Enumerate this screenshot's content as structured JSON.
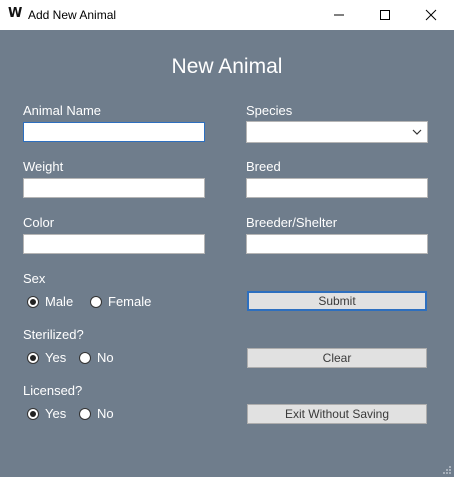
{
  "window": {
    "title": "Add New Animal",
    "icon_letter": "W",
    "controls": [
      "minimize-icon",
      "maximize-icon",
      "close-icon"
    ]
  },
  "form": {
    "title": "New Animal",
    "left": {
      "animal_name": {
        "label": "Animal Name",
        "value": ""
      },
      "weight": {
        "label": "Weight",
        "value": ""
      },
      "color": {
        "label": "Color",
        "value": ""
      }
    },
    "right": {
      "species": {
        "label": "Species",
        "selected": ""
      },
      "breed": {
        "label": "Breed",
        "value": ""
      },
      "breeder_shelter": {
        "label": "Breeder/Shelter",
        "value": ""
      }
    },
    "sex": {
      "label": "Sex",
      "options": [
        "Male",
        "Female"
      ],
      "selected": "Male"
    },
    "sterilized": {
      "label": "Sterilized?",
      "options": [
        "Yes",
        "No"
      ],
      "selected": "Yes"
    },
    "licensed": {
      "label": "Licensed?",
      "options": [
        "Yes",
        "No"
      ],
      "selected": "Yes"
    },
    "buttons": {
      "submit": "Submit",
      "clear": "Clear",
      "exit": "Exit Without Saving"
    }
  },
  "colors": {
    "background": "#6f7d8c",
    "focus_border": "#2d6fbf",
    "button_face": "#e1e1e1"
  }
}
